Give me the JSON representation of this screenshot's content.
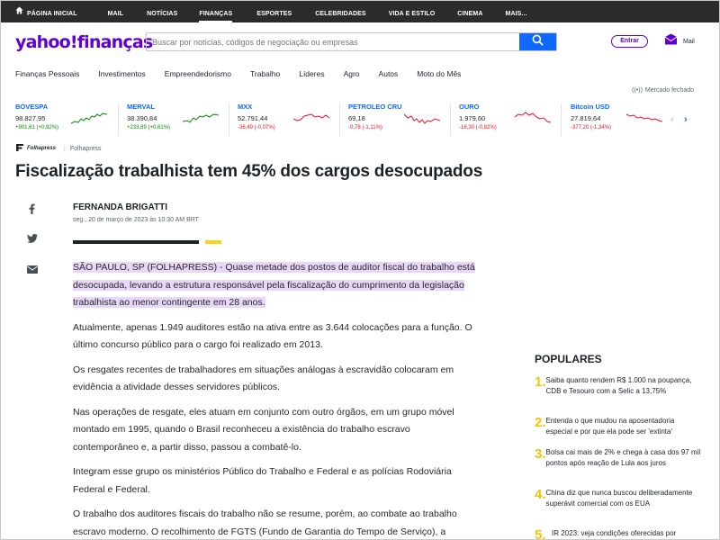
{
  "topnav": {
    "items": [
      {
        "label": "PÁGINA INICIAL"
      },
      {
        "label": "MAIL"
      },
      {
        "label": "NOTÍCIAS"
      },
      {
        "label": "FINANÇAS"
      },
      {
        "label": "ESPORTES"
      },
      {
        "label": "CELEBRIDADES"
      },
      {
        "label": "VIDA E ESTILO"
      },
      {
        "label": "CINEMA"
      },
      {
        "label": "MAIS..."
      }
    ]
  },
  "header": {
    "logo": "yahoo!finanças",
    "search_placeholder": "Buscar por notícias, códigos de negociação ou empresas",
    "signin_label": "Entrar",
    "mail_label": "Mail"
  },
  "subnav": {
    "items": [
      "Finanças Pessoais",
      "Investimentos",
      "Empreendedorismo",
      "Trabalho",
      "Líderes",
      "Agro",
      "Autos",
      "Moto do Mês"
    ]
  },
  "market": {
    "status": "Mercado fechado",
    "tickers": [
      {
        "name": "BOVESPA",
        "value": "98.827,95",
        "change": "+901,61 (+0,92%)",
        "direction": "up",
        "color": "#008a00"
      },
      {
        "name": "MERVAL",
        "value": "38.390,84",
        "change": "+233,89 (+0,61%)",
        "direction": "up",
        "color": "#008a00"
      },
      {
        "name": "MXX",
        "value": "52.791,44",
        "change": "-36,49 (-0,07%)",
        "direction": "down",
        "color": "#eb0f29"
      },
      {
        "name": "PETROLEO CRU",
        "value": "69,18",
        "change": "-0,78 (-1,11%)",
        "direction": "down",
        "color": "#eb0f29"
      },
      {
        "name": "OURO",
        "value": "1.979,60",
        "change": "-16,30 (-0,82%)",
        "direction": "down",
        "color": "#eb0f29"
      },
      {
        "name": "Bitcoin USD",
        "value": "27.819,64",
        "change": "-377,20 (-1,34%)",
        "direction": "down",
        "color": "#eb0f29"
      }
    ]
  },
  "article": {
    "source_logo": "Folhapress",
    "source": "Folhapress",
    "title": "Fiscalização trabalhista tem 45% dos cargos desocupados",
    "author": "FERNANDA BRIGATTI",
    "date": "seg., 20 de março de 2023 às 10:30 AM BRT",
    "paragraphs": [
      "SÃO PAULO, SP (FOLHAPRESS) - Quase metade dos postos de auditor fiscal do trabalho está desocupada, levando a estrutura responsável pela fiscalização do cumprimento da legislação trabalhista ao menor contingente em 28 anos.",
      "Atualmente, apenas 1.949 auditores estão na ativa entre as 3.644 colocações para a função. O último concurso público para o cargo foi realizado em 2013.",
      "Os resgates recentes de trabalhadores em situações análogas à escravidão colocaram em evidência a atividade desses servidores públicos.",
      "Nas operações de resgate, eles atuam em conjunto com outro órgãos, em um grupo móvel montado em 1995, quando o Brasil reconheceu a existência do trabalho escravo contemporâneo e, a partir disso, passou a combatê-lo.",
      "Integram esse grupo os ministérios Público do Trabalho e Federal e as polícias Rodoviária Federal e Federal.",
      "O trabalho dos auditores fiscais do trabalho não se resume, porém, ao combate ao trabalho escravo moderno. O recolhimento de FGTS (Fundo de Garantia do Tempo de Serviço), a"
    ]
  },
  "populares": {
    "title": "POPULARES",
    "items": [
      {
        "num": "1.",
        "text": "Saiba quanto rendem R$ 1.000 na poupança, CDB e Tesouro com a Selic a 13,75%"
      },
      {
        "num": "2.",
        "text": "Entenda o que mudou na aposentadoria especial e por que ela pode ser 'extinta'"
      },
      {
        "num": "3.",
        "text": "Bolsa cai mais de 2% e chega à casa dos 97 mil pontos após reação de Lula aos juros"
      },
      {
        "num": "4.",
        "text": "China diz que nunca buscou deliberadamente superávit comercial com os EUA"
      },
      {
        "num": "5.",
        "text": "IR 2023: veja condições oferecidas por"
      }
    ]
  },
  "colors": {
    "brand": "#6001d2",
    "accent": "#0f69ff",
    "highlight": "#e8d7f7",
    "popular_number": "#f5c400"
  },
  "icons": [
    "home-icon",
    "search-icon",
    "mail-icon",
    "facebook-icon",
    "twitter-icon",
    "email-icon",
    "broadcast-icon",
    "chevron-left-icon",
    "chevron-right-icon"
  ]
}
